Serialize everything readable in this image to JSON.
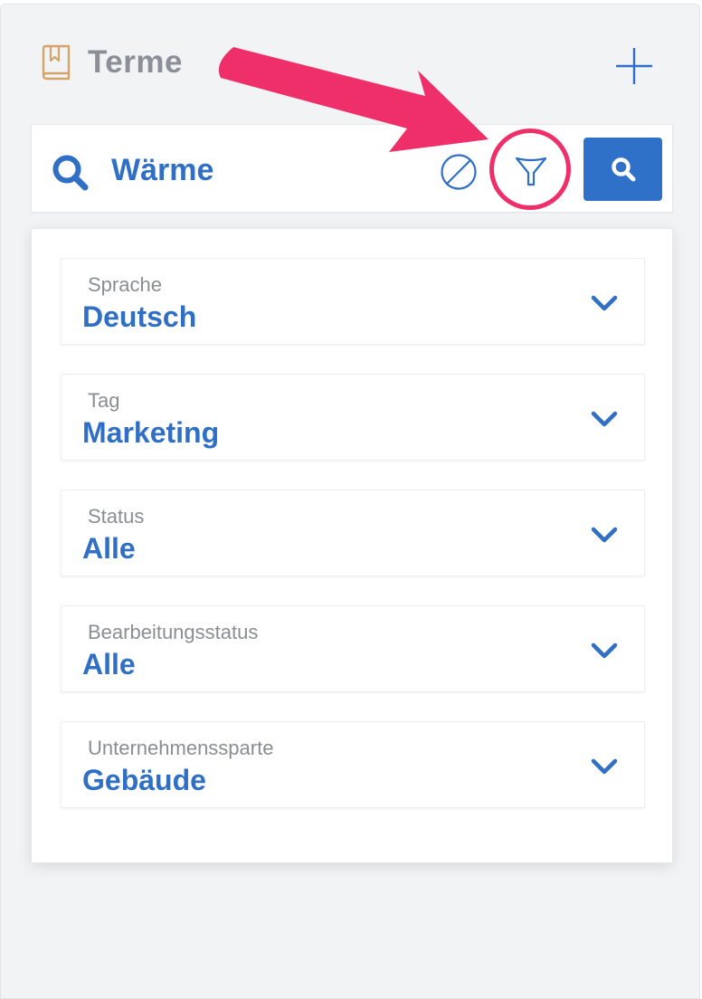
{
  "header": {
    "title": "Terme",
    "icon": "book-icon",
    "add_icon": "plus-icon"
  },
  "search": {
    "value": "Wärme",
    "icons": {
      "search": "search-icon",
      "clear": "clear-icon",
      "filter": "filter-icon",
      "submit": "search-icon"
    }
  },
  "filters": [
    {
      "label": "Sprache",
      "value": "Deutsch"
    },
    {
      "label": "Tag",
      "value": "Marketing"
    },
    {
      "label": "Status",
      "value": "Alle"
    },
    {
      "label": "Bearbeitungsstatus",
      "value": "Alle"
    },
    {
      "label": "Unternehmenssparte",
      "value": "Gebäude"
    }
  ],
  "colors": {
    "accent": "#2f6fc5",
    "header_icon": "#d4a46a",
    "annotation": "#ef2f6a",
    "panel_bg": "#f2f3f4"
  }
}
